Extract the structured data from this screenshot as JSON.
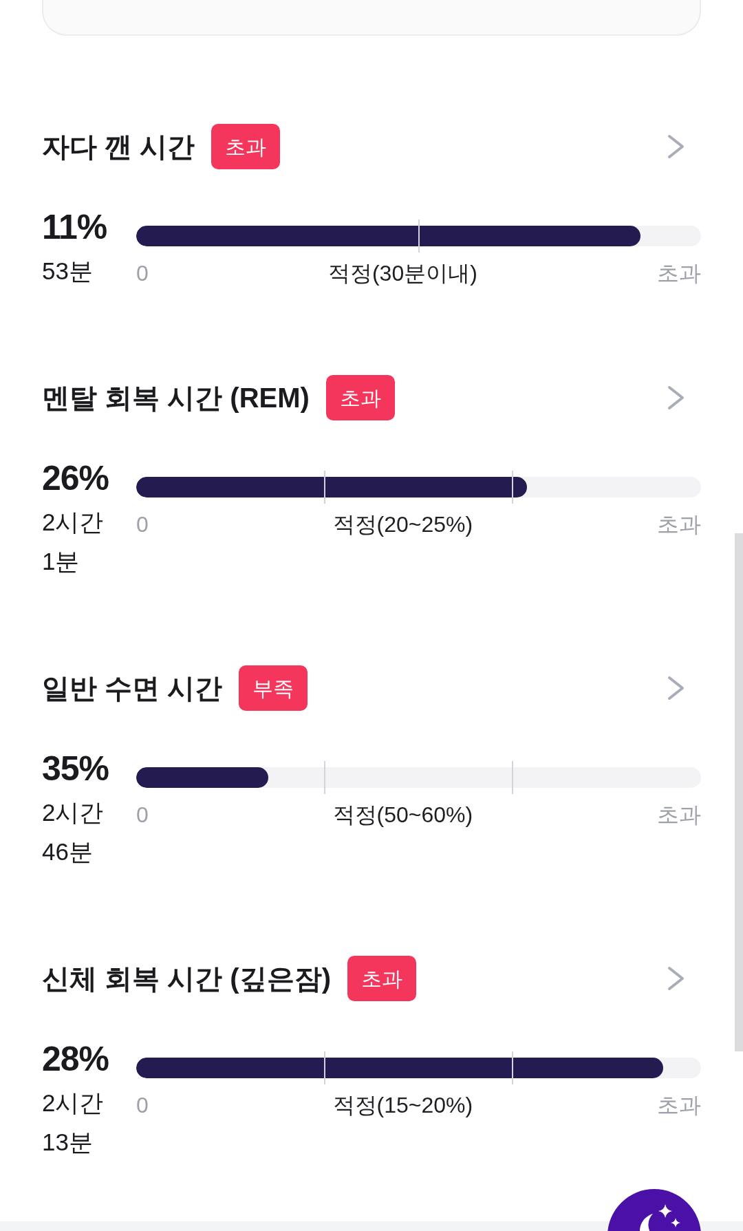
{
  "stages": [
    {
      "title": "자다 깬 시간",
      "badge": "초과",
      "kind": "limit",
      "percent": "11%",
      "duration": "53분",
      "level": 0.893,
      "scale": {
        "start": "0",
        "target": "적정(30분이내)",
        "end": "초과"
      }
    },
    {
      "title": "멘탈 회복 시간 (REM)",
      "badge": "초과",
      "kind": "range",
      "percent": "26%",
      "duration": "2시간 1분",
      "level": 0.692,
      "scale": {
        "start": "0",
        "target": "적정(20~25%)",
        "end": "초과"
      }
    },
    {
      "title": "일반 수면 시간",
      "badge": "부족",
      "kind": "range",
      "percent": "35%",
      "duration": "2시간 46분",
      "level": 0.234,
      "scale": {
        "start": "0",
        "target": "적정(50~60%)",
        "end": "초과"
      }
    },
    {
      "title": "신체 회복 시간 (깊은잠)",
      "badge": "초과",
      "kind": "range",
      "percent": "28%",
      "duration": "2시간 13분",
      "level": 0.933,
      "scale": {
        "start": "0",
        "target": "적정(15~20%)",
        "end": "초과"
      }
    }
  ]
}
